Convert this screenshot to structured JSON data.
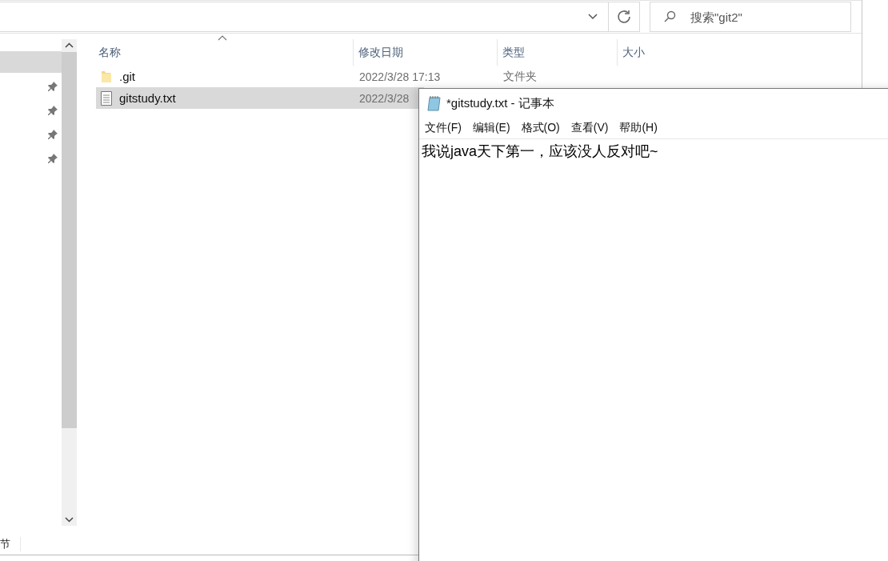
{
  "explorer": {
    "search": {
      "placeholder": "搜索\"git2\""
    },
    "nav_items": [
      {
        "selected": true,
        "pinned": false
      },
      {
        "selected": false,
        "pinned": true
      },
      {
        "selected": false,
        "pinned": true
      },
      {
        "selected": false,
        "pinned": true
      },
      {
        "selected": false,
        "pinned": true
      }
    ],
    "columns": [
      "名称",
      "修改日期",
      "类型",
      "大小"
    ],
    "rows": [
      {
        "kind": "folder",
        "name": ".git",
        "date": "2022/3/28 17:13",
        "type": "文件夹",
        "selected": false
      },
      {
        "kind": "text",
        "name": "gitstudy.txt",
        "date": "2022/3/28",
        "selected": true
      }
    ],
    "status_bar": "节"
  },
  "notepad": {
    "title": "*gitstudy.txt - 记事本",
    "menu": [
      "文件(F)",
      "编辑(E)",
      "格式(O)",
      "查看(V)",
      "帮助(H)"
    ],
    "content": "我说java天下第一，应该没人反对吧~"
  }
}
